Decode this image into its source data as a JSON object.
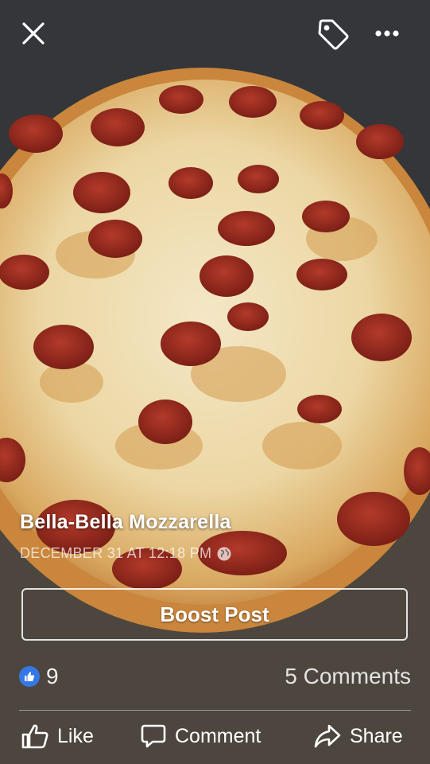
{
  "post": {
    "title": "Bella-Bella Mozzarella",
    "timestamp": "DECEMBER 31 AT 12:18 PM",
    "privacy_icon": "globe-icon"
  },
  "toolbar": {
    "close_icon": "close-icon",
    "tag_icon": "tag-icon",
    "more_icon": "more-icon"
  },
  "boost": {
    "label": "Boost Post"
  },
  "stats": {
    "likes": "9",
    "comments": "5 Comments"
  },
  "actions": {
    "like": "Like",
    "comment": "Comment",
    "share": "Share"
  },
  "colors": {
    "like_blue": "#3578e5",
    "overlay_text": "#ffffff"
  }
}
